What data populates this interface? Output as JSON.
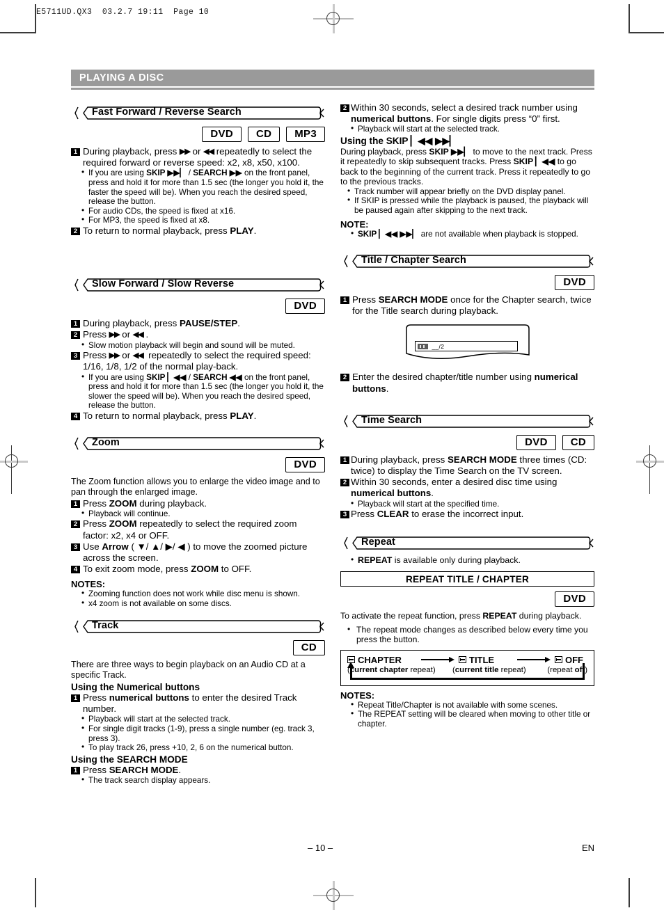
{
  "meta": {
    "file_header": "E5711UD.QX3  03.2.7 19:11  Page 10"
  },
  "banner": {
    "title": "PLAYING A DISC"
  },
  "footer": {
    "page": "– 10 –",
    "language": "EN"
  },
  "left_column": {
    "sections": [
      {
        "title": "Fast Forward / Reverse Search",
        "badges": [
          "DVD",
          "CD",
          "MP3"
        ],
        "steps": [
          {
            "num": "1",
            "text_html": "During playback, press <span class=\"g gb\">▶▶</span> or <span class=\"g gb\">◀◀</span> repeatedly to select the required forward or reverse speed: x2, x8, x50, x100."
          },
          {
            "num": "2",
            "text_html": "To return to normal playback, press <b>PLAY</b>."
          }
        ],
        "bullets_after_step1": [
          "If you are using <b>SKIP ▶▶▏</b> / <b>SEARCH ▶▶</b> on the front panel, press and hold it for more than 1.5 sec (the longer you hold it, the faster the speed will be).  When you reach the desired speed, release the button.",
          "For audio CDs, the speed is fixed at x16.",
          "For MP3, the speed is fixed at x8."
        ]
      },
      {
        "title": "Slow Forward / Slow Reverse",
        "badges": [
          "DVD"
        ],
        "steps": [
          {
            "num": "1",
            "text_html": "During playback, press <b>PAUSE/STEP</b>."
          },
          {
            "num": "2",
            "text_html": "Press <span class=\"g gb\">▶▶</span> or <span class=\"g gb\">◀◀</span> ."
          },
          {
            "num": "3",
            "text_html": "Press <span class=\"g gb\">▶▶</span> or <span class=\"g gb\">◀◀</span>&nbsp; repeatedly to select the required speed: 1/16, 1/8, 1/2 of the normal play-back."
          },
          {
            "num": "4",
            "text_html": "To return to normal playback, press <b>PLAY</b>."
          }
        ],
        "bullet_step2": "Slow motion playback will begin and sound will be muted.",
        "bullet_step3": "If you are using <b>SKIP ▏◀◀</b> / <b>SEARCH ◀◀</b> on the front panel, press and hold it for more than 1.5 sec (the longer you hold it, the slower the speed will be).  When you reach the desired speed, release the button."
      },
      {
        "title": "Zoom",
        "badges": [
          "DVD"
        ],
        "intro": "The Zoom function allows you to enlarge the video image and to pan through the enlarged image.",
        "steps": [
          {
            "num": "1",
            "text_html": "Press <b>ZOOM</b> during playback."
          },
          {
            "num": "2",
            "text_html": "Press <b>ZOOM</b> repeatedly to select the required zoom factor: x2, x4 or OFF."
          },
          {
            "num": "3",
            "text_html": "Use <b>Arrow</b> ( ▼/ ▲/ ▶/ ◀ ) to move the zoomed picture across the screen."
          },
          {
            "num": "4",
            "text_html": "To exit zoom mode, press <b>ZOOM</b> to OFF."
          }
        ],
        "bullet_step1": "Playback will continue.",
        "notes_label": "NOTES:",
        "notes": [
          "Zooming function does not work while disc menu is shown.",
          "x4 zoom is not available on some discs."
        ]
      },
      {
        "title": "Track",
        "badges": [
          "CD"
        ],
        "intro": "There are three ways to begin playback on an Audio CD at a specific Track.",
        "sub1": "Using the Numerical buttons",
        "step_num1": {
          "num": "1",
          "text_html": "Press <b>numerical buttons</b> to enter the desired Track number."
        },
        "bullets1": [
          "Playback will start at the selected track.",
          "For single digit tracks (1-9), press a single number (eg. track 3, press 3).",
          "To play track 26, press +10, 2, 6 on the numerical button."
        ],
        "sub2": "Using the SEARCH MODE",
        "step_num2": {
          "num": "1",
          "text_html": "Press <b>SEARCH MODE</b>."
        },
        "bullets2": [
          "The track search display appears."
        ]
      }
    ]
  },
  "right_column": {
    "track_continued": {
      "step2": {
        "num": "2",
        "text_html": "Within 30 seconds, select a desired track number using <b>numerical buttons</b>.  For single digits press “0” first."
      },
      "bullet": "Playback will start at the selected track.",
      "sub_skip": "Using the SKIP ▏◀◀ ▶▶▏",
      "paragraph": "During playback, press <b>SKIP ▶▶▏</b> to move to the next track. Press it repeatedly to skip subsequent tracks.  Press <b>SKIP ▏◀◀</b> to go back to the beginning of the current track.  Press it repeatedly to go to the previous tracks.",
      "bullets": [
        "Track number will appear briefly on the DVD display panel.",
        "If SKIP is pressed while the playback is paused, the playback will be paused again after skipping to the next track."
      ],
      "note_label": "NOTE:",
      "note_bullets": [
        "<b>SKIP ▏◀◀ ▶▶▏</b> are not available when playback is stopped."
      ]
    },
    "sections": [
      {
        "title": "Title / Chapter Search",
        "badges": [
          "DVD"
        ],
        "steps": [
          {
            "num": "1",
            "text_html": "Press <b>SEARCH MODE</b> once for the Chapter search, twice for the Title search during playback."
          },
          {
            "num": "2",
            "text_html": "Enter the desired chapter/title number using <b>numerical buttons</b>."
          }
        ],
        "osd_text": "__/2"
      },
      {
        "title": "Time Search",
        "badges": [
          "DVD",
          "CD"
        ],
        "steps": [
          {
            "num": "1",
            "text_html": "During playback, press <b>SEARCH MODE</b> three times (CD: twice) to display the Time Search on the TV screen."
          },
          {
            "num": "2",
            "text_html": "Within 30 seconds, enter a desired disc time using <b>numerical buttons</b>."
          },
          {
            "num": "3",
            "text_html": "Press <b>CLEAR</b> to erase the incorrect input."
          }
        ],
        "bullet_step2": "Playback will start at the specified time."
      },
      {
        "title": "Repeat",
        "top_bullet": "<b>REPEAT</b> is available only during playback.",
        "box_title": "REPEAT TITLE / CHAPTER",
        "badges": [
          "DVD"
        ],
        "activate_text": "To activate the repeat function, press <b>REPEAT</b> during playback.",
        "change_bullet": "The repeat mode changes as described below every time you press the button.",
        "flow": {
          "items": [
            {
              "label": "CHAPTER",
              "sub_html": "(<b>current chapter</b> repeat)"
            },
            {
              "label": "TITLE",
              "sub_html": "(<b>current title</b> repeat)"
            },
            {
              "label": "OFF",
              "sub_html": "(repeat <b>off</b>)"
            }
          ]
        },
        "notes_label": "NOTES:",
        "notes": [
          "Repeat Title/Chapter is not available with some scenes.",
          "The REPEAT setting will be cleared when moving to other title or chapter."
        ]
      }
    ]
  },
  "colors": {
    "banner_gray": "#9a9a9a",
    "ink": "#000000"
  }
}
